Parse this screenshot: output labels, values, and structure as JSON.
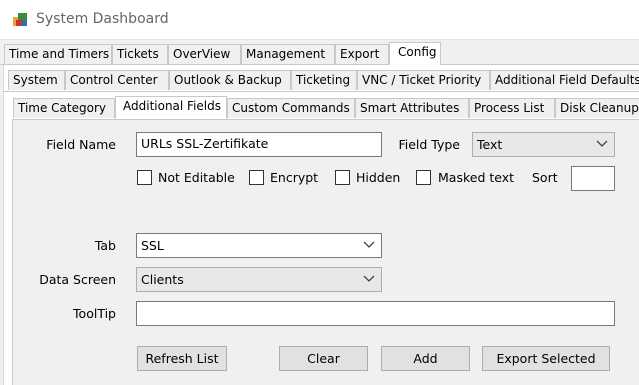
{
  "window": {
    "title": "System Dashboard"
  },
  "main_tabs": [
    "Time and Timers",
    "Tickets",
    "OverView",
    "Management",
    "Export",
    "Config"
  ],
  "config_tabs": [
    "System",
    "Control Center",
    "Outlook & Backup",
    "Ticketing",
    "VNC / Ticket Priority",
    "Additional Field Defaults"
  ],
  "system_tabs": [
    "Time Category",
    "Additional Fields",
    "Custom Commands",
    "Smart Attributes",
    "Process List",
    "Disk Cleanup"
  ],
  "form": {
    "field_name_label": "Field Name",
    "field_name_value": "URLs SSL-Zertifikate",
    "field_type_label": "Field Type",
    "field_type_value": "Text",
    "not_editable": "Not Editable",
    "encrypt": "Encrypt",
    "hidden": "Hidden",
    "masked_text": "Masked text",
    "sort_label": "Sort",
    "sort_value": "",
    "tab_label": "Tab",
    "tab_value": "SSL",
    "data_screen_label": "Data Screen",
    "data_screen_value": "Clients",
    "tooltip_label": "ToolTip",
    "tooltip_value": ""
  },
  "buttons": {
    "refresh": "Refresh List",
    "clear": "Clear",
    "add": "Add",
    "export": "Export Selected"
  }
}
